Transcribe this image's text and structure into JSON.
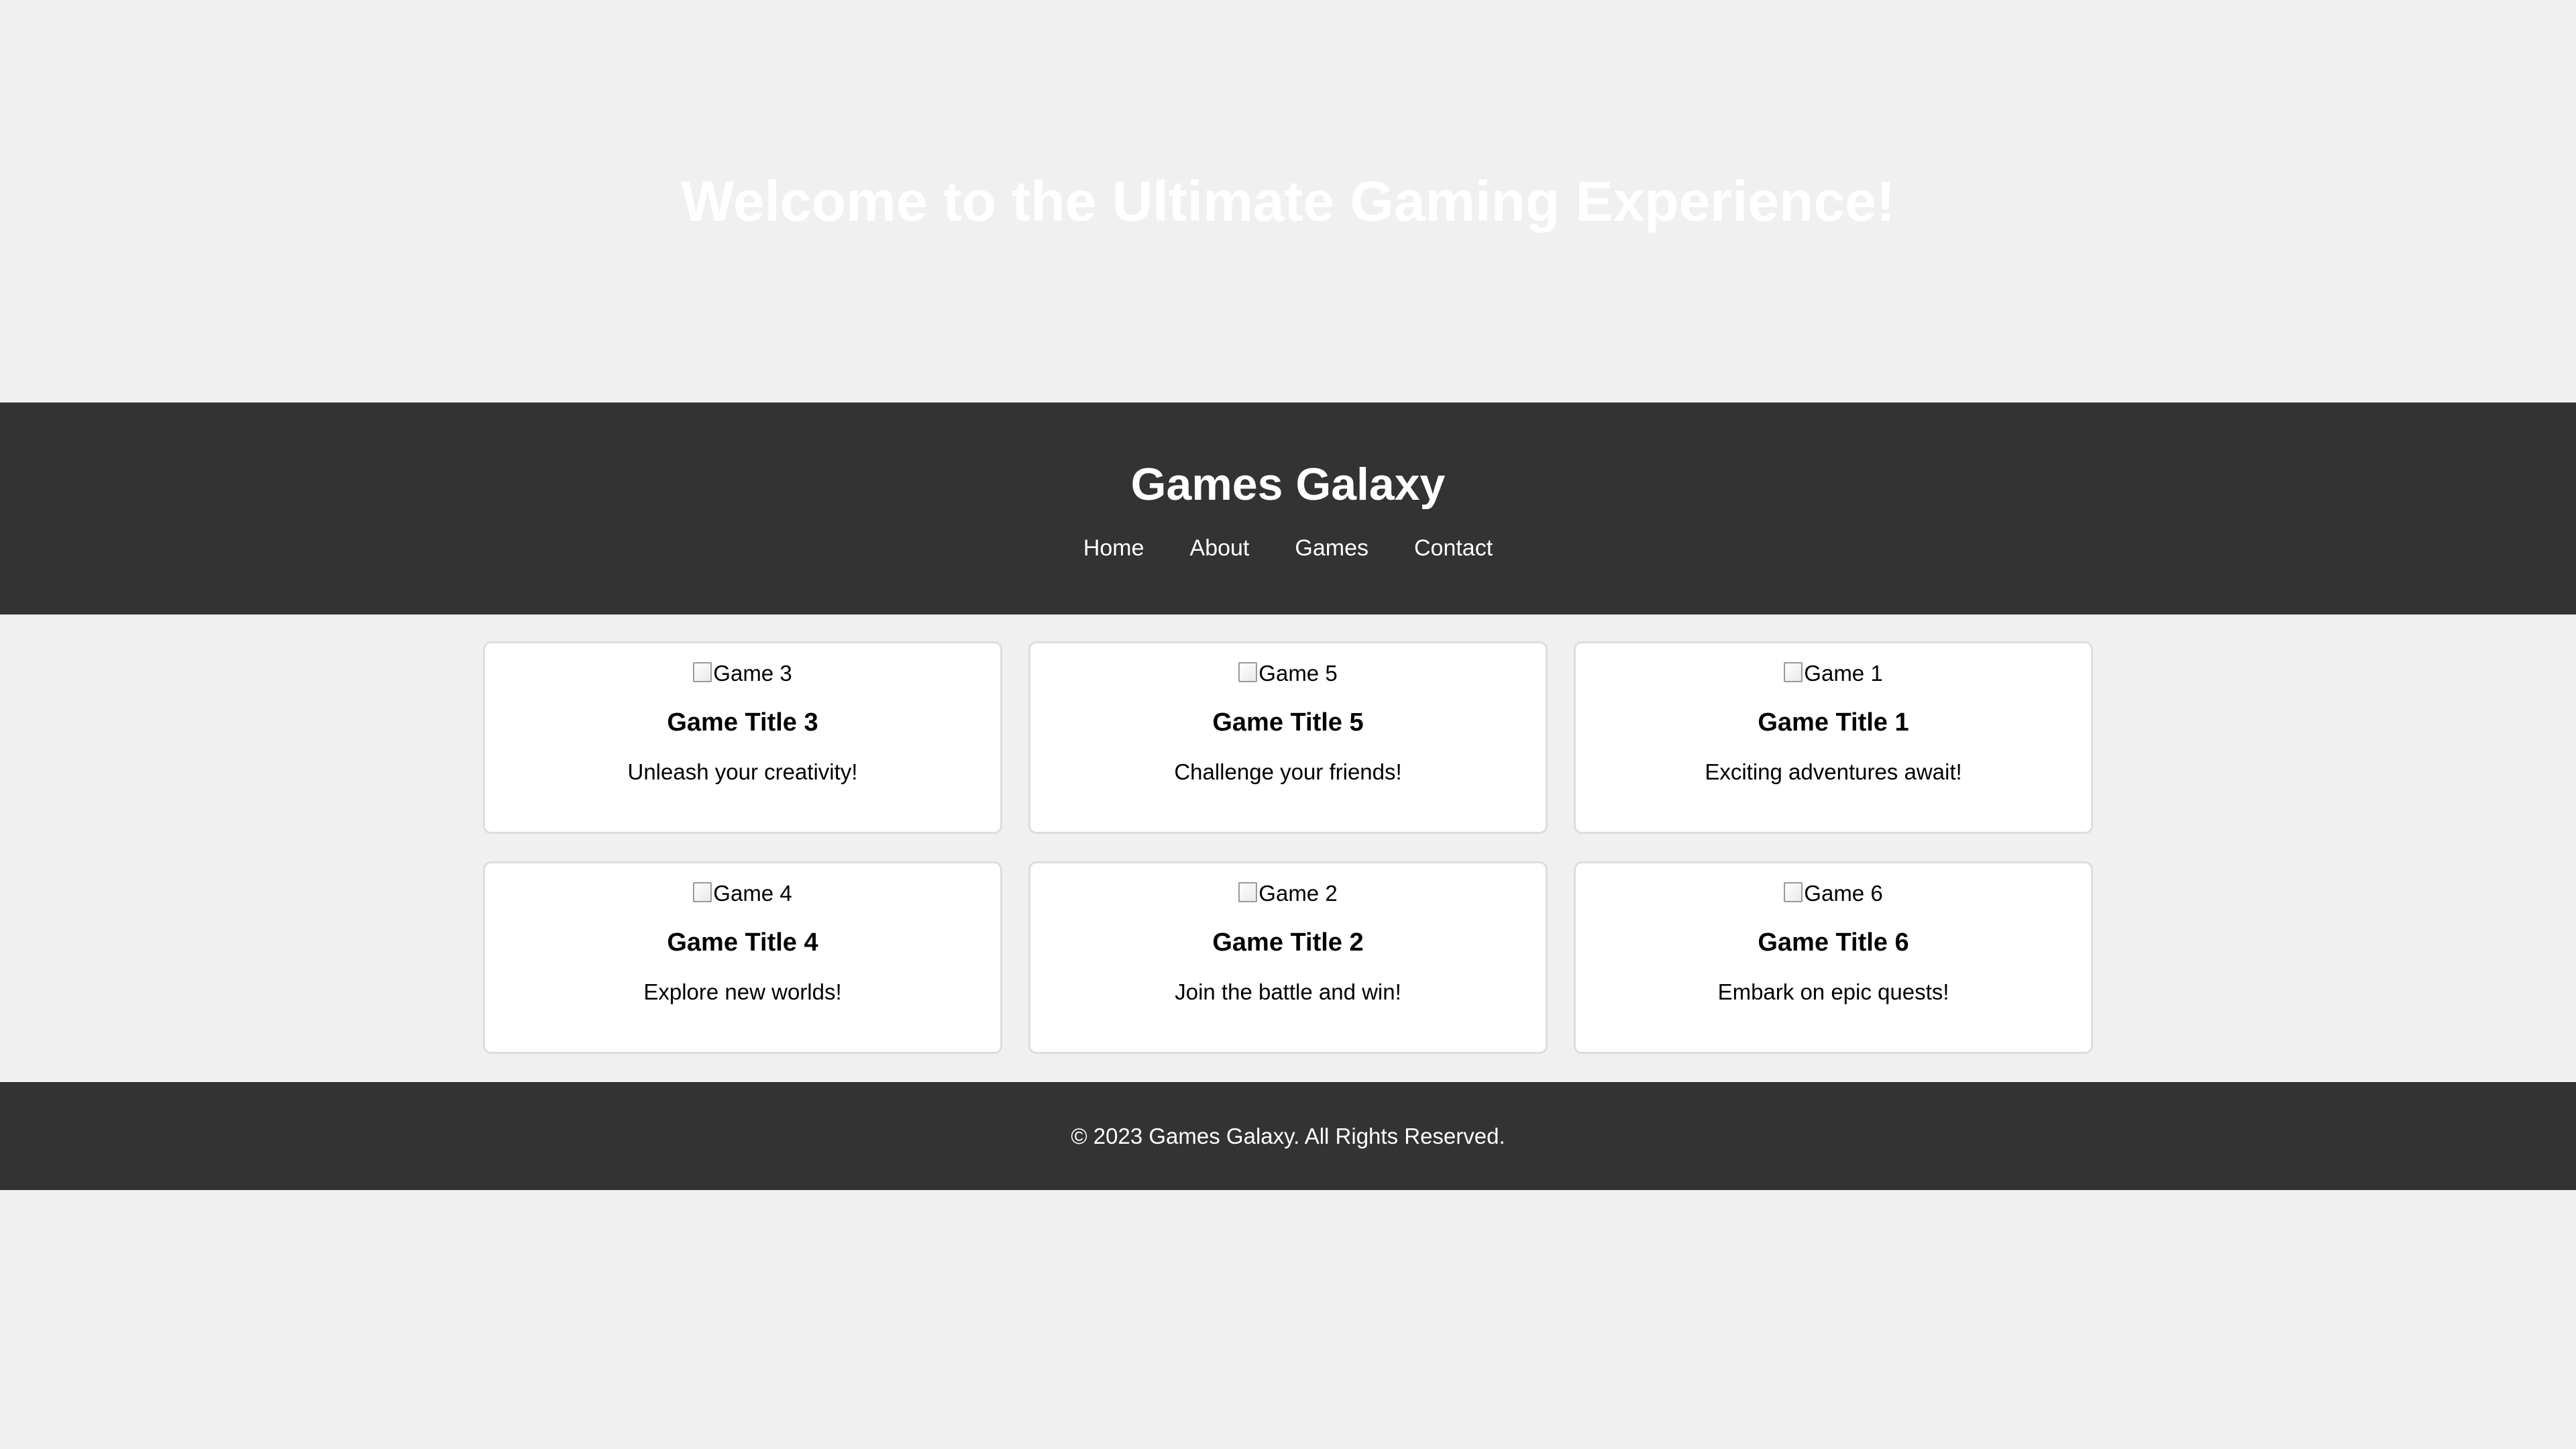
{
  "hero": {
    "title": "Welcome to the Ultimate Gaming Experience!"
  },
  "header": {
    "site_title": "Games Galaxy",
    "nav": [
      {
        "label": "Home"
      },
      {
        "label": "About"
      },
      {
        "label": "Games"
      },
      {
        "label": "Contact"
      }
    ]
  },
  "games": [
    {
      "image_alt": "Game 3",
      "title": "Game Title 3",
      "description": "Unleash your creativity!"
    },
    {
      "image_alt": "Game 5",
      "title": "Game Title 5",
      "description": "Challenge your friends!"
    },
    {
      "image_alt": "Game 1",
      "title": "Game Title 1",
      "description": "Exciting adventures await!"
    },
    {
      "image_alt": "Game 4",
      "title": "Game Title 4",
      "description": "Explore new worlds!"
    },
    {
      "image_alt": "Game 2",
      "title": "Game Title 2",
      "description": "Join the battle and win!"
    },
    {
      "image_alt": "Game 6",
      "title": "Game Title 6",
      "description": "Embark on epic quests!"
    }
  ],
  "footer": {
    "text": "© 2023 Games Galaxy. All Rights Reserved."
  },
  "colors": {
    "page_background": "#f0f0f0",
    "header_background": "#333333",
    "card_background": "#ffffff",
    "card_border": "#dddddd",
    "hero_text": "#ffffff"
  },
  "icons": {
    "card_image": "broken-image-icon"
  }
}
